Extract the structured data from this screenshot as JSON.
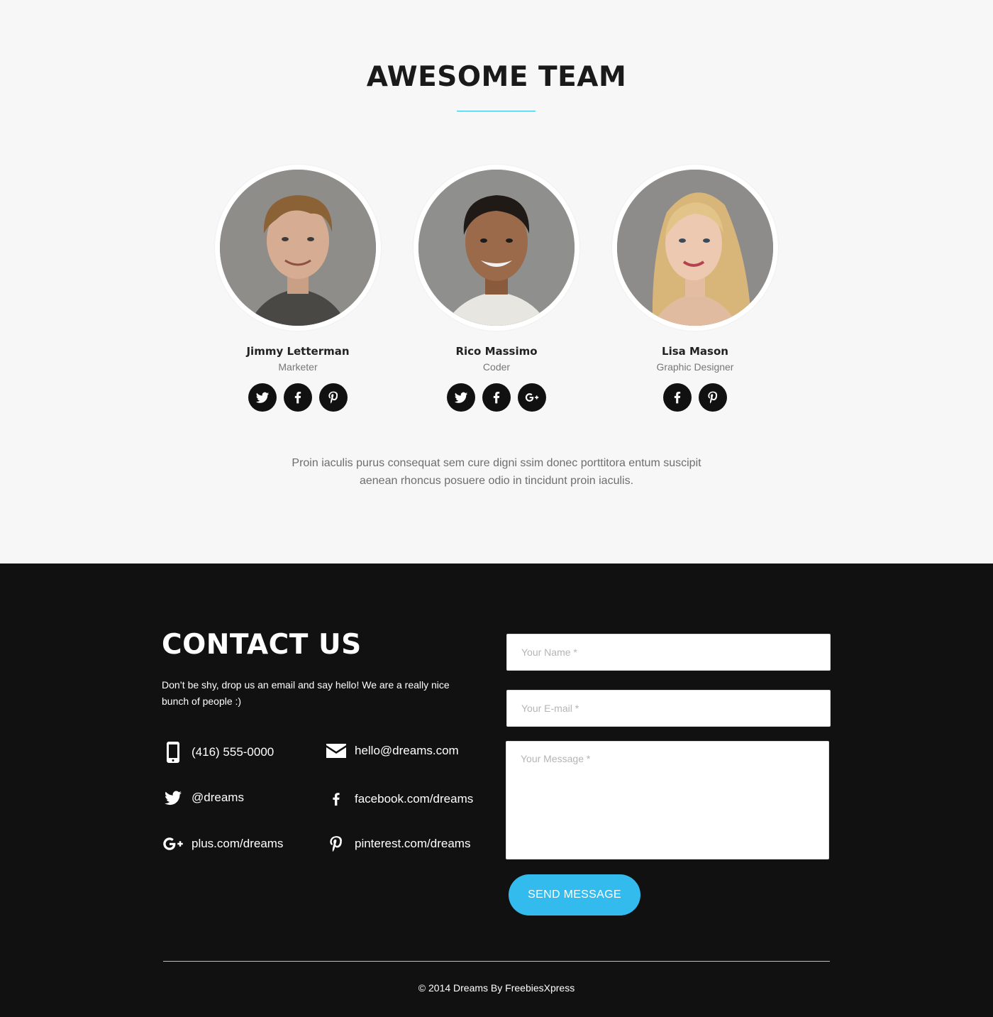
{
  "team": {
    "title": "AWESOME TEAM",
    "accent_color": "#33bbee",
    "members": [
      {
        "name": "Jimmy Letterman",
        "role": "Marketer",
        "socials": [
          "twitter-icon",
          "facebook-icon",
          "pinterest-icon"
        ]
      },
      {
        "name": "Rico Massimo",
        "role": "Coder",
        "socials": [
          "twitter-icon",
          "facebook-icon",
          "google-plus-icon"
        ]
      },
      {
        "name": "Lisa Mason",
        "role": "Graphic Designer",
        "socials": [
          "facebook-icon",
          "pinterest-icon"
        ]
      }
    ],
    "description": "Proin iaculis purus consequat sem cure  digni ssim donec porttitora entum suscipit aenean rhoncus posuere odio in tincidunt proin iaculis."
  },
  "contact": {
    "title": "CONTACT US",
    "intro": "Don’t be shy, drop us an email and say hello! We are a really nice bunch of people :)",
    "phone": "(416) 555-0000",
    "email": "hello@dreams.com",
    "twitter": "@dreams",
    "facebook": "facebook.com/dreams",
    "google_plus": "plus.com/dreams",
    "pinterest": "pinterest.com/dreams",
    "form": {
      "name_placeholder": "Your Name *",
      "email_placeholder": "Your E-mail *",
      "message_placeholder": "Your Message *",
      "send_label": "SEND MESSAGE"
    }
  },
  "footer": {
    "copyright": "© 2014 Dreams By FreebiesXpress"
  },
  "colors": {
    "background_light": "#f7f7f7",
    "background_dark": "#111111",
    "accent": "#33bbee"
  }
}
